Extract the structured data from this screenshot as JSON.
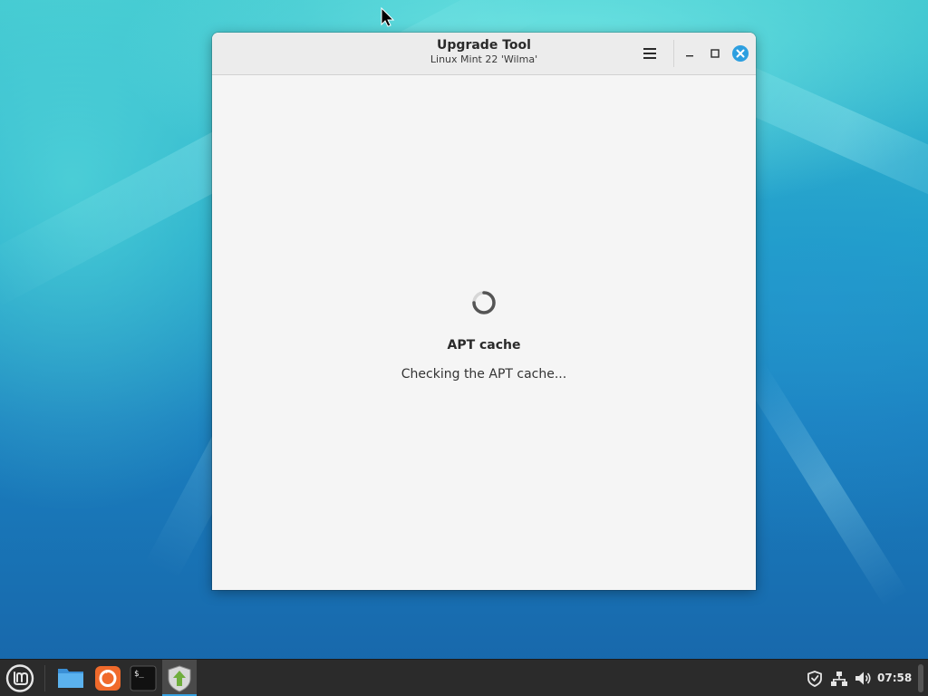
{
  "window": {
    "title": "Upgrade Tool",
    "subtitle": "Linux Mint 22 'Wilma'"
  },
  "status": {
    "title": "APT cache",
    "message": "Checking the APT cache..."
  },
  "taskbar": {
    "launchers": [
      "mint-menu-icon",
      "files-icon",
      "firefox-icon",
      "terminal-icon",
      "upgrade-tool-icon"
    ],
    "active_launcher": "upgrade-tool-icon",
    "clock": "07:58"
  },
  "colors": {
    "accent": "#35a0e0",
    "close_button": "#2d9fe0",
    "taskbar": "#2b2b2b",
    "window_bg": "#f5f5f5"
  }
}
